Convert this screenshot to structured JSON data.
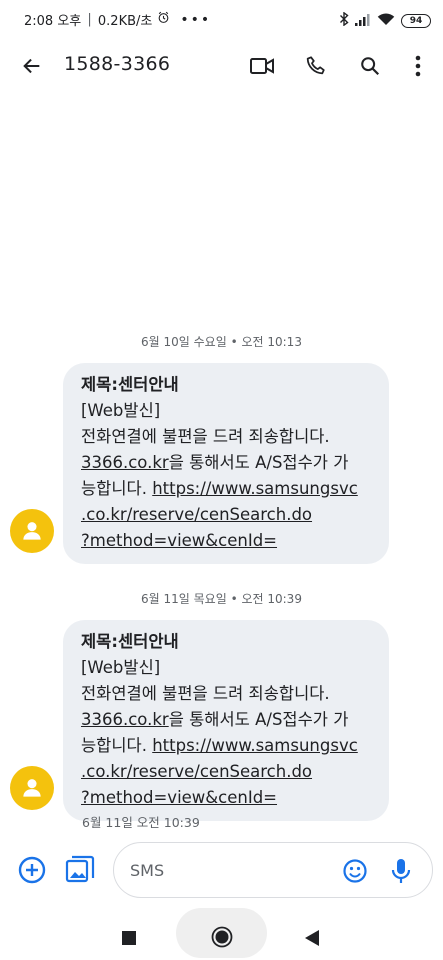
{
  "status_bar": {
    "time": "2:08 오후",
    "data_speed": "0.2KB/초",
    "battery": "94"
  },
  "app_bar": {
    "contact": "1588-3366",
    "icons": [
      "back-arrow-icon",
      "video-call-icon",
      "phone-icon",
      "search-icon",
      "more-vert-icon"
    ]
  },
  "messages": [
    {
      "date": "6월 10일 수요일 • 오전 10:13",
      "line1": "제목:센터안내",
      "line2": "[Web발신]",
      "line3": "전화연결에 불편을 드려 죄송합니다.",
      "line4_link": "3366.co.kr",
      "line4_text": "을 통해서도 A/S접수가 가",
      "line5_text": "능합니다. ",
      "line5_link": "https://www.samsungsvc",
      "line6_link": ".co.kr/reserve/cenSearch.do",
      "line7_link": "?method=view&cenId="
    },
    {
      "date": "6월 11일 목요일 • 오전 10:39",
      "line1": "제목:센터안내",
      "line2": "[Web발신]",
      "line3": "전화연결에 불편을 드려 죄송합니다.",
      "line4_link": "3366.co.kr",
      "line4_text": "을 통해서도 A/S접수가 가",
      "line5_text": "능합니다. ",
      "line5_link": "https://www.samsungsvc",
      "line6_link": ".co.kr/reserve/cenSearch.do",
      "line7_link": "?method=view&cenId=",
      "time": "6월 11일 오전 10:39"
    }
  ],
  "compose": {
    "placeholder": "SMS"
  },
  "colors": {
    "bubble": "#eceff3",
    "avatar": "#f4c20d",
    "accent": "#1a73e8"
  }
}
